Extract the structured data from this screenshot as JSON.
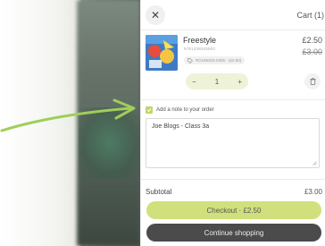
{
  "colors": {
    "accent_green": "#d1e07c",
    "dark_button": "#4b4b4b",
    "arrow_green": "#9fce5a"
  },
  "header": {
    "close_icon": "close-icon",
    "cart_title": "Cart (1)"
  },
  "product": {
    "title": "Freestyle",
    "code": "9781338345902",
    "discount_code": "ROUND03-0306 · (£0.50)",
    "price_now": "£2.50",
    "price_was": "£3.00",
    "quantity": "1",
    "minus_label": "−",
    "plus_label": "+",
    "trash_icon": "trash-icon"
  },
  "note": {
    "checkbox_checked": true,
    "label": "Add a note to your order",
    "value": "Joe Blogs - Class 3a"
  },
  "summary": {
    "subtotal_label": "Subtotal",
    "subtotal_value": "£3.00"
  },
  "buttons": {
    "checkout": "Checkout · £2.50",
    "continue": "Continue shopping"
  }
}
